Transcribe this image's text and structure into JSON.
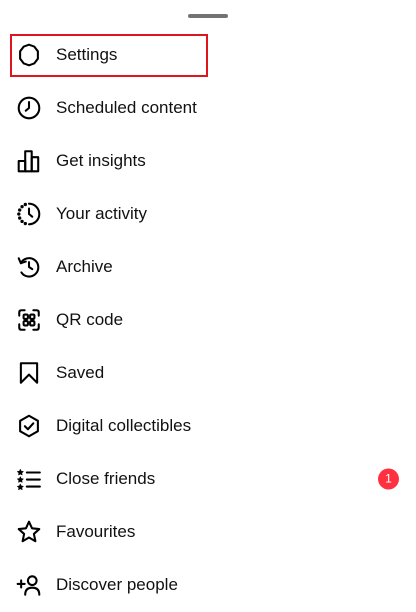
{
  "menu": {
    "items": [
      {
        "label": "Settings",
        "icon": "settings-gear-icon"
      },
      {
        "label": "Scheduled content",
        "icon": "clock-icon"
      },
      {
        "label": "Get insights",
        "icon": "bar-chart-icon"
      },
      {
        "label": "Your activity",
        "icon": "activity-clock-icon"
      },
      {
        "label": "Archive",
        "icon": "archive-history-icon"
      },
      {
        "label": "QR code",
        "icon": "qr-code-icon"
      },
      {
        "label": "Saved",
        "icon": "bookmark-icon"
      },
      {
        "label": "Digital collectibles",
        "icon": "shield-check-icon"
      },
      {
        "label": "Close friends",
        "icon": "close-friends-list-icon",
        "badge": "1"
      },
      {
        "label": "Favourites",
        "icon": "star-icon"
      },
      {
        "label": "Discover people",
        "icon": "add-person-icon"
      }
    ]
  },
  "colors": {
    "badge": "#ff3040",
    "highlight": "#e0141d",
    "handle": "#737373"
  }
}
